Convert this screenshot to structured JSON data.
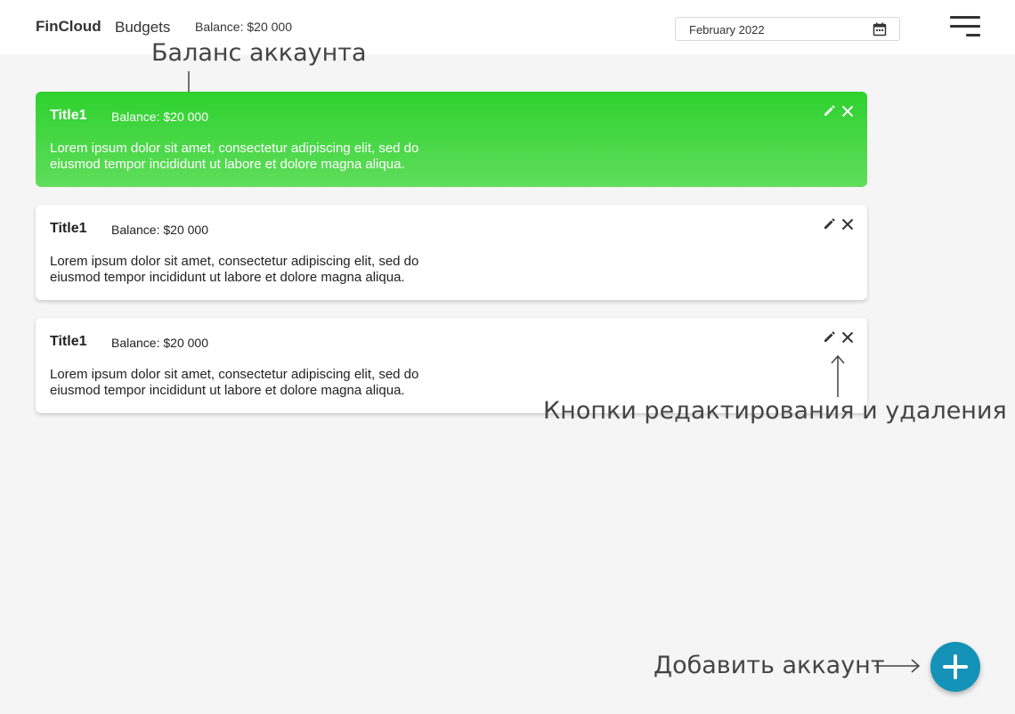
{
  "header": {
    "brand": "FinCloud",
    "nav_budgets": "Budgets",
    "balance": "Balance: $20 000",
    "date_value": "February 2022"
  },
  "cards": [
    {
      "title": "Title1",
      "balance": "Balance: $20 000",
      "description": "Lorem ipsum dolor sit amet, consectetur adipiscing elit, sed do eiusmod tempor incididunt ut labore et dolore magna aliqua.",
      "active": true
    },
    {
      "title": "Title1",
      "balance": "Balance: $20 000",
      "description": "Lorem ipsum dolor sit amet, consectetur adipiscing elit, sed do eiusmod tempor incididunt ut labore et dolore magna aliqua.",
      "active": false
    },
    {
      "title": "Title1",
      "balance": "Balance: $20 000",
      "description": "Lorem ipsum dolor sit amet, consectetur adipiscing elit, sed do eiusmod tempor incididunt ut labore et dolore magna aliqua.",
      "active": false
    }
  ],
  "annotations": {
    "balance_note": "Баланс аккаунта",
    "buttons_note": "Кнопки редактирования и  удаления",
    "add_note": "Добавить аккаунт"
  },
  "icons": {
    "calendar": "calendar-icon",
    "menu": "hamburger-icon",
    "edit": "pencil-icon",
    "delete": "close-icon",
    "add": "plus-icon"
  },
  "colors": {
    "active_card_top": "#2ed12e",
    "active_card_bottom": "#60dd5c",
    "fab": "#1592b8",
    "background": "#f5f5f5"
  }
}
